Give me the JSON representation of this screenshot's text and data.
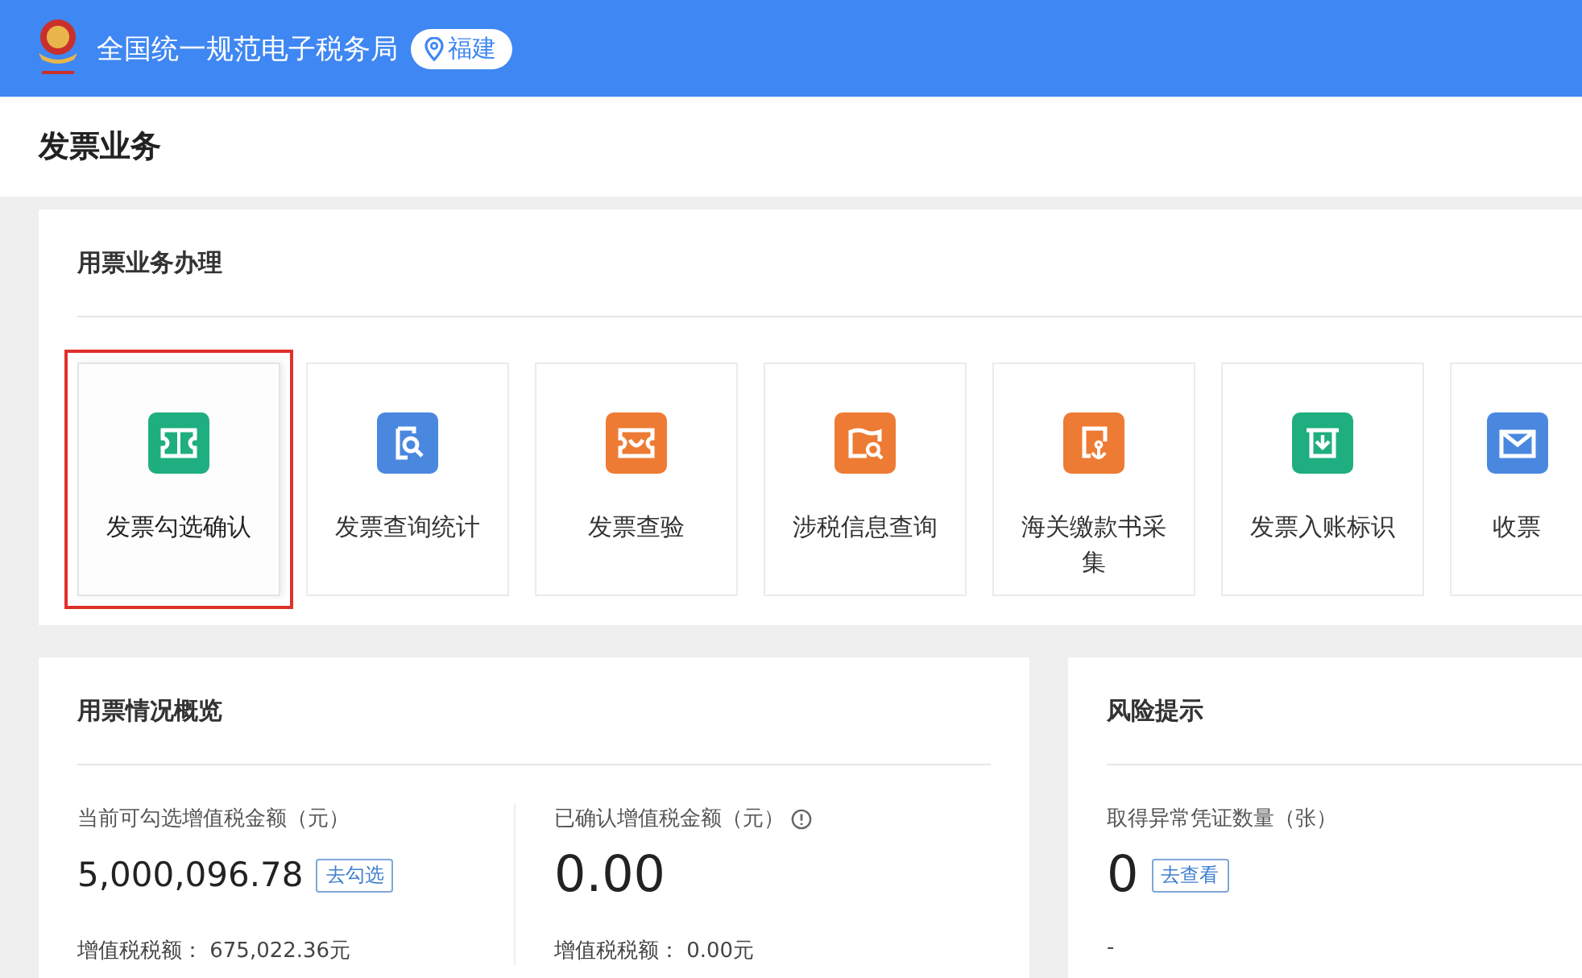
{
  "header": {
    "title": "全国统一规范电子税务局",
    "location": "福建"
  },
  "page_title": "发票业务",
  "business": {
    "title": "用票业务办理",
    "tiles": [
      {
        "label": "发票勾选确认",
        "kind": "ticket",
        "color": "#1fae7f",
        "selected": true
      },
      {
        "label": "发票查询统计",
        "kind": "search-doc",
        "color": "#4a88e0",
        "selected": false
      },
      {
        "label": "发票查验",
        "kind": "ticket-check",
        "color": "#ee7b33",
        "selected": false
      },
      {
        "label": "涉税信息查询",
        "kind": "map-search",
        "color": "#ee7b33",
        "selected": false
      },
      {
        "label": "海关缴款书采集",
        "kind": "anchor-doc",
        "color": "#ee7b33",
        "selected": false
      },
      {
        "label": "发票入账标识",
        "kind": "ticket-down",
        "color": "#1fae7f",
        "selected": false
      },
      {
        "label": "收票",
        "kind": "mail",
        "color": "#4a88e0",
        "selected": false
      }
    ]
  },
  "overview": {
    "title": "用票情况概览",
    "stats": [
      {
        "label": "当前可勾选增值税金额（元）",
        "value": "5,000,096.78",
        "action": "去勾选",
        "info": false,
        "sub": "增值税税额：  675,022.36元"
      },
      {
        "label": "已确认增值税金额（元）",
        "value": "0.00",
        "info": true,
        "sub": "增值税税额：  0.00元"
      }
    ]
  },
  "risk": {
    "title": "风险提示",
    "label": "取得异常凭证数量（张）",
    "value": "0",
    "action": "去查看",
    "sub": "-"
  }
}
